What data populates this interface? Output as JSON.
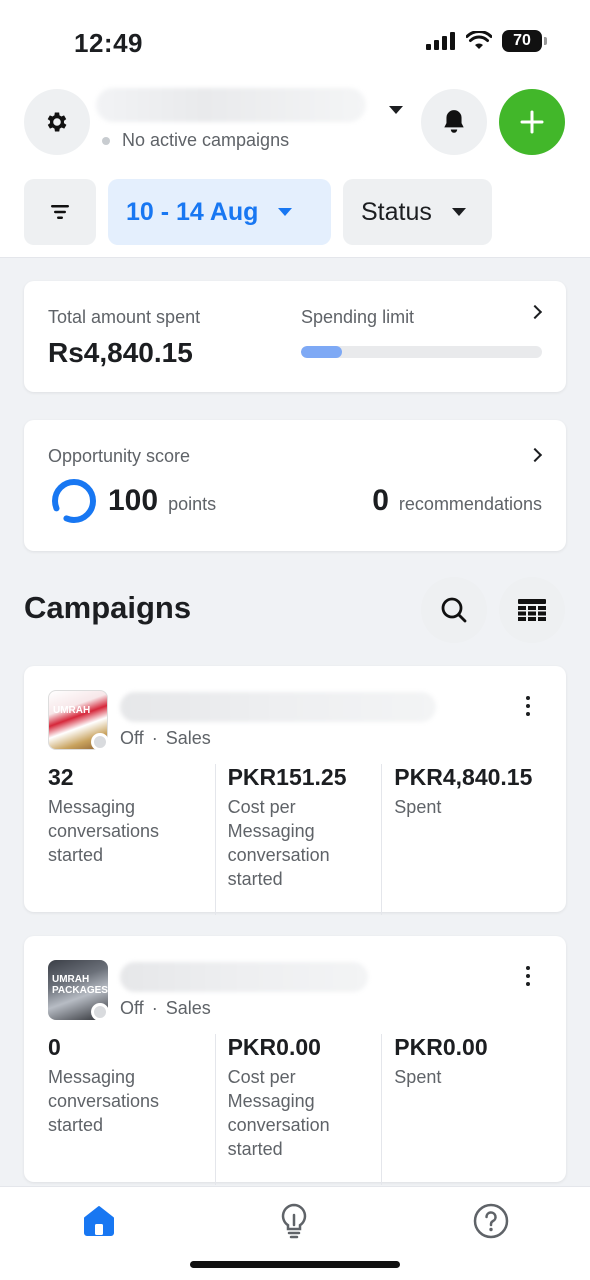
{
  "status_bar": {
    "time": "12:49",
    "battery": "70"
  },
  "header": {
    "account_status": "No active campaigns"
  },
  "filters": {
    "date_range": "10 - 14 Aug",
    "status": "Status"
  },
  "summary": {
    "total_spent_label": "Total amount spent",
    "total_spent_value": "Rs4,840.15",
    "spending_limit_label": "Spending limit",
    "spending_limit_fraction": 0.17
  },
  "opportunity": {
    "label": "Opportunity score",
    "points_value": "100",
    "points_unit": "points",
    "recs_value": "0",
    "recs_unit": "recommendations"
  },
  "campaigns": {
    "title": "Campaigns",
    "items": [
      {
        "status": "Off",
        "objective": "Sales",
        "thumb_text": "UMRAH",
        "metrics": [
          {
            "value": "32",
            "label": "Messaging conversations started"
          },
          {
            "value": "PKR151.25",
            "label": "Cost per Messaging conversation started"
          },
          {
            "value": "PKR4,840.15",
            "label": "Spent"
          }
        ]
      },
      {
        "status": "Off",
        "objective": "Sales",
        "thumb_text": "UMRAH PACKAGES",
        "metrics": [
          {
            "value": "0",
            "label": "Messaging conversations started"
          },
          {
            "value": "PKR0.00",
            "label": "Cost per Messaging conversation started"
          },
          {
            "value": "PKR0.00",
            "label": "Spent"
          }
        ]
      }
    ]
  },
  "icons": {
    "settings": "gear-icon",
    "notifications": "bell-icon",
    "create": "plus-icon",
    "filter": "filter-icon",
    "search": "search-icon",
    "table": "table-icon",
    "home": "home-icon",
    "ideas": "lightbulb-icon",
    "help": "help-icon"
  },
  "colors": {
    "accent_blue": "#1877f2",
    "create_green": "#42b72a",
    "date_chip_bg": "#e4effd"
  }
}
